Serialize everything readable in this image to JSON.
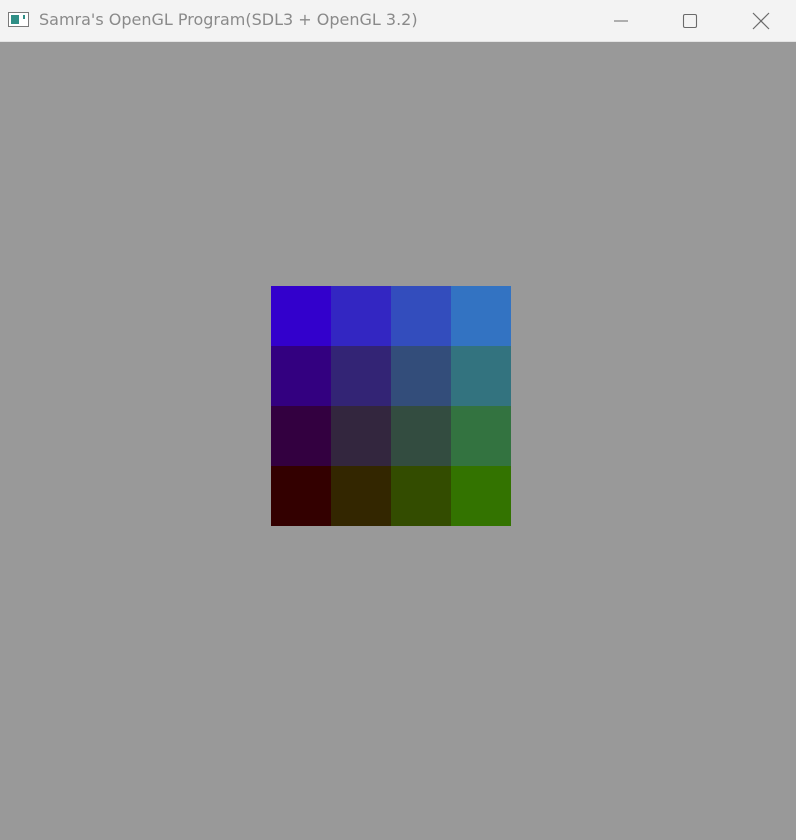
{
  "window": {
    "title": "Samra's OpenGL Program(SDL3 + OpenGL 3.2)",
    "controls": {
      "minimize_icon": "minimize-icon",
      "maximize_icon": "maximize-icon",
      "close_icon": "close-icon"
    }
  },
  "canvas": {
    "clear_color": "#999999",
    "color_grid": {
      "rows": [
        [
          "#3300cc",
          "#3326c2",
          "#334dbd",
          "#3373c2"
        ],
        [
          "#330080",
          "#332475",
          "#334d7a",
          "#33737f"
        ],
        [
          "#330040",
          "#33263e",
          "#334c40",
          "#337340"
        ],
        [
          "#330000",
          "#332600",
          "#334c00",
          "#337300"
        ]
      ]
    }
  }
}
